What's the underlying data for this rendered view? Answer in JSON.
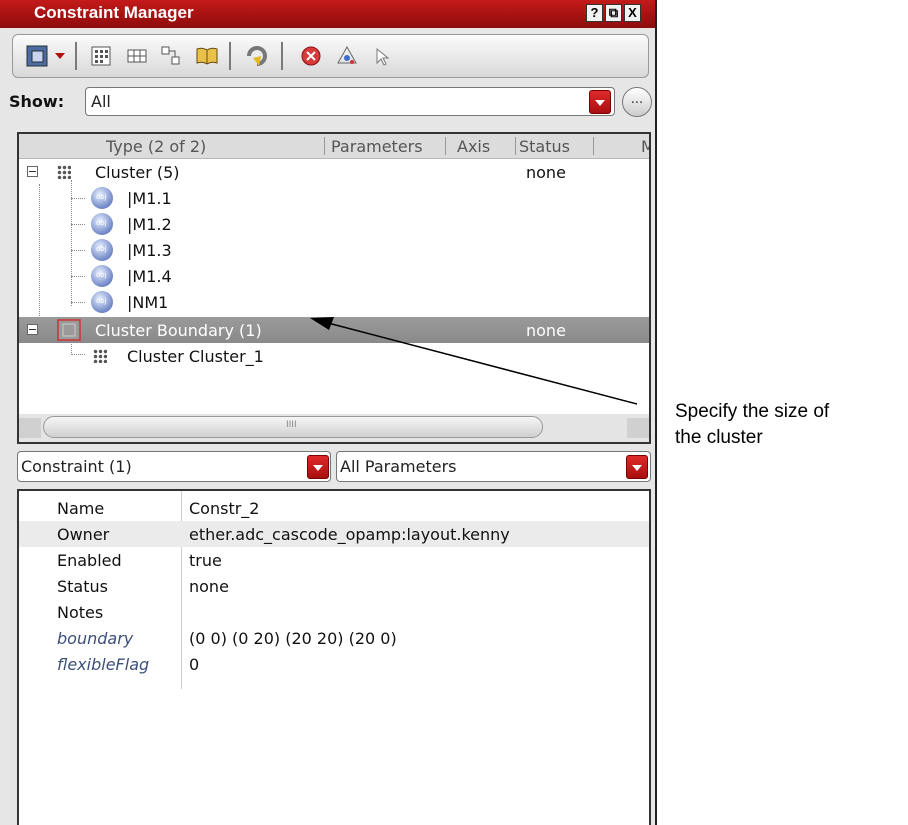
{
  "window": {
    "title": "Constraint Manager",
    "help": "?",
    "restore": "⧉",
    "close": "X"
  },
  "toolbar": {
    "icons": [
      "constraint-icon",
      "dropdown-arrow-icon",
      "grid-icon",
      "row-icon",
      "group-icon",
      "book-icon",
      "update-icon",
      "delete-icon",
      "check-icon",
      "cursor-icon"
    ]
  },
  "show": {
    "label": "Show:",
    "value": "All",
    "more": "..."
  },
  "tree": {
    "columns": [
      "Type (2 of 2)",
      "Parameters",
      "Axis",
      "Status",
      "M"
    ],
    "rows": [
      {
        "label": "Cluster (5)",
        "status": "none"
      },
      {
        "label": "|M1.1"
      },
      {
        "label": "|M1.2"
      },
      {
        "label": "|M1.3"
      },
      {
        "label": "|M1.4"
      },
      {
        "label": "|NM1"
      },
      {
        "label": "Cluster Boundary (1)",
        "status": "none"
      },
      {
        "label": "Cluster Cluster_1"
      }
    ],
    "scroll_grip": "IIII"
  },
  "constraint_select": {
    "value": "Constraint (1)"
  },
  "param_select": {
    "value": "All Parameters"
  },
  "properties": [
    {
      "key": "Name",
      "value": "Constr_2"
    },
    {
      "key": "Owner",
      "value": "ether.adc_cascode_opamp:layout.kenny"
    },
    {
      "key": "Enabled",
      "value": "true"
    },
    {
      "key": "Status",
      "value": "none"
    },
    {
      "key": "Notes",
      "value": ""
    },
    {
      "key": "boundary",
      "value": "(0 0) (0 20) (20 20) (20 0)"
    },
    {
      "key": "flexibleFlag",
      "value": "0"
    }
  ],
  "annotation": {
    "line1": "Specify the size of",
    "line2": "the cluster"
  },
  "colors": {
    "titlebar": "#a81414",
    "selection": "#8e8e8e",
    "dropdown": "#c01818"
  }
}
